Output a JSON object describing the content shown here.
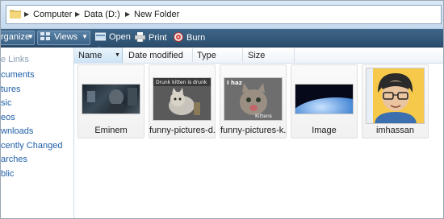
{
  "address": {
    "crumbs": [
      "Computer",
      "Data (D:)",
      "New Folder"
    ]
  },
  "toolbar": {
    "organize_label": "rganize",
    "views_label": "Views",
    "open_label": "Open",
    "print_label": "Print",
    "burn_label": "Burn"
  },
  "sidebar": {
    "heading": "e Links",
    "items": [
      {
        "label": "cuments"
      },
      {
        "label": "tures"
      },
      {
        "label": "sic"
      },
      {
        "label": "eos"
      },
      {
        "label": "wnloads"
      },
      {
        "label": "cently Changed"
      },
      {
        "label": "arches"
      },
      {
        "label": "blic"
      }
    ]
  },
  "columns": {
    "name": "Name",
    "date_modified": "Date modified",
    "type": "Type",
    "size": "Size"
  },
  "files": [
    {
      "name": "Eminem"
    },
    {
      "name": "funny-pictures-d..."
    },
    {
      "name": "funny-pictures-k..."
    },
    {
      "name": "Image"
    },
    {
      "name": "imhassan"
    }
  ],
  "thumb_text": {
    "funny_d": "Drunk kitten is drunk",
    "funny_k": "I haz",
    "funny_k_bottom": "Kittens"
  }
}
